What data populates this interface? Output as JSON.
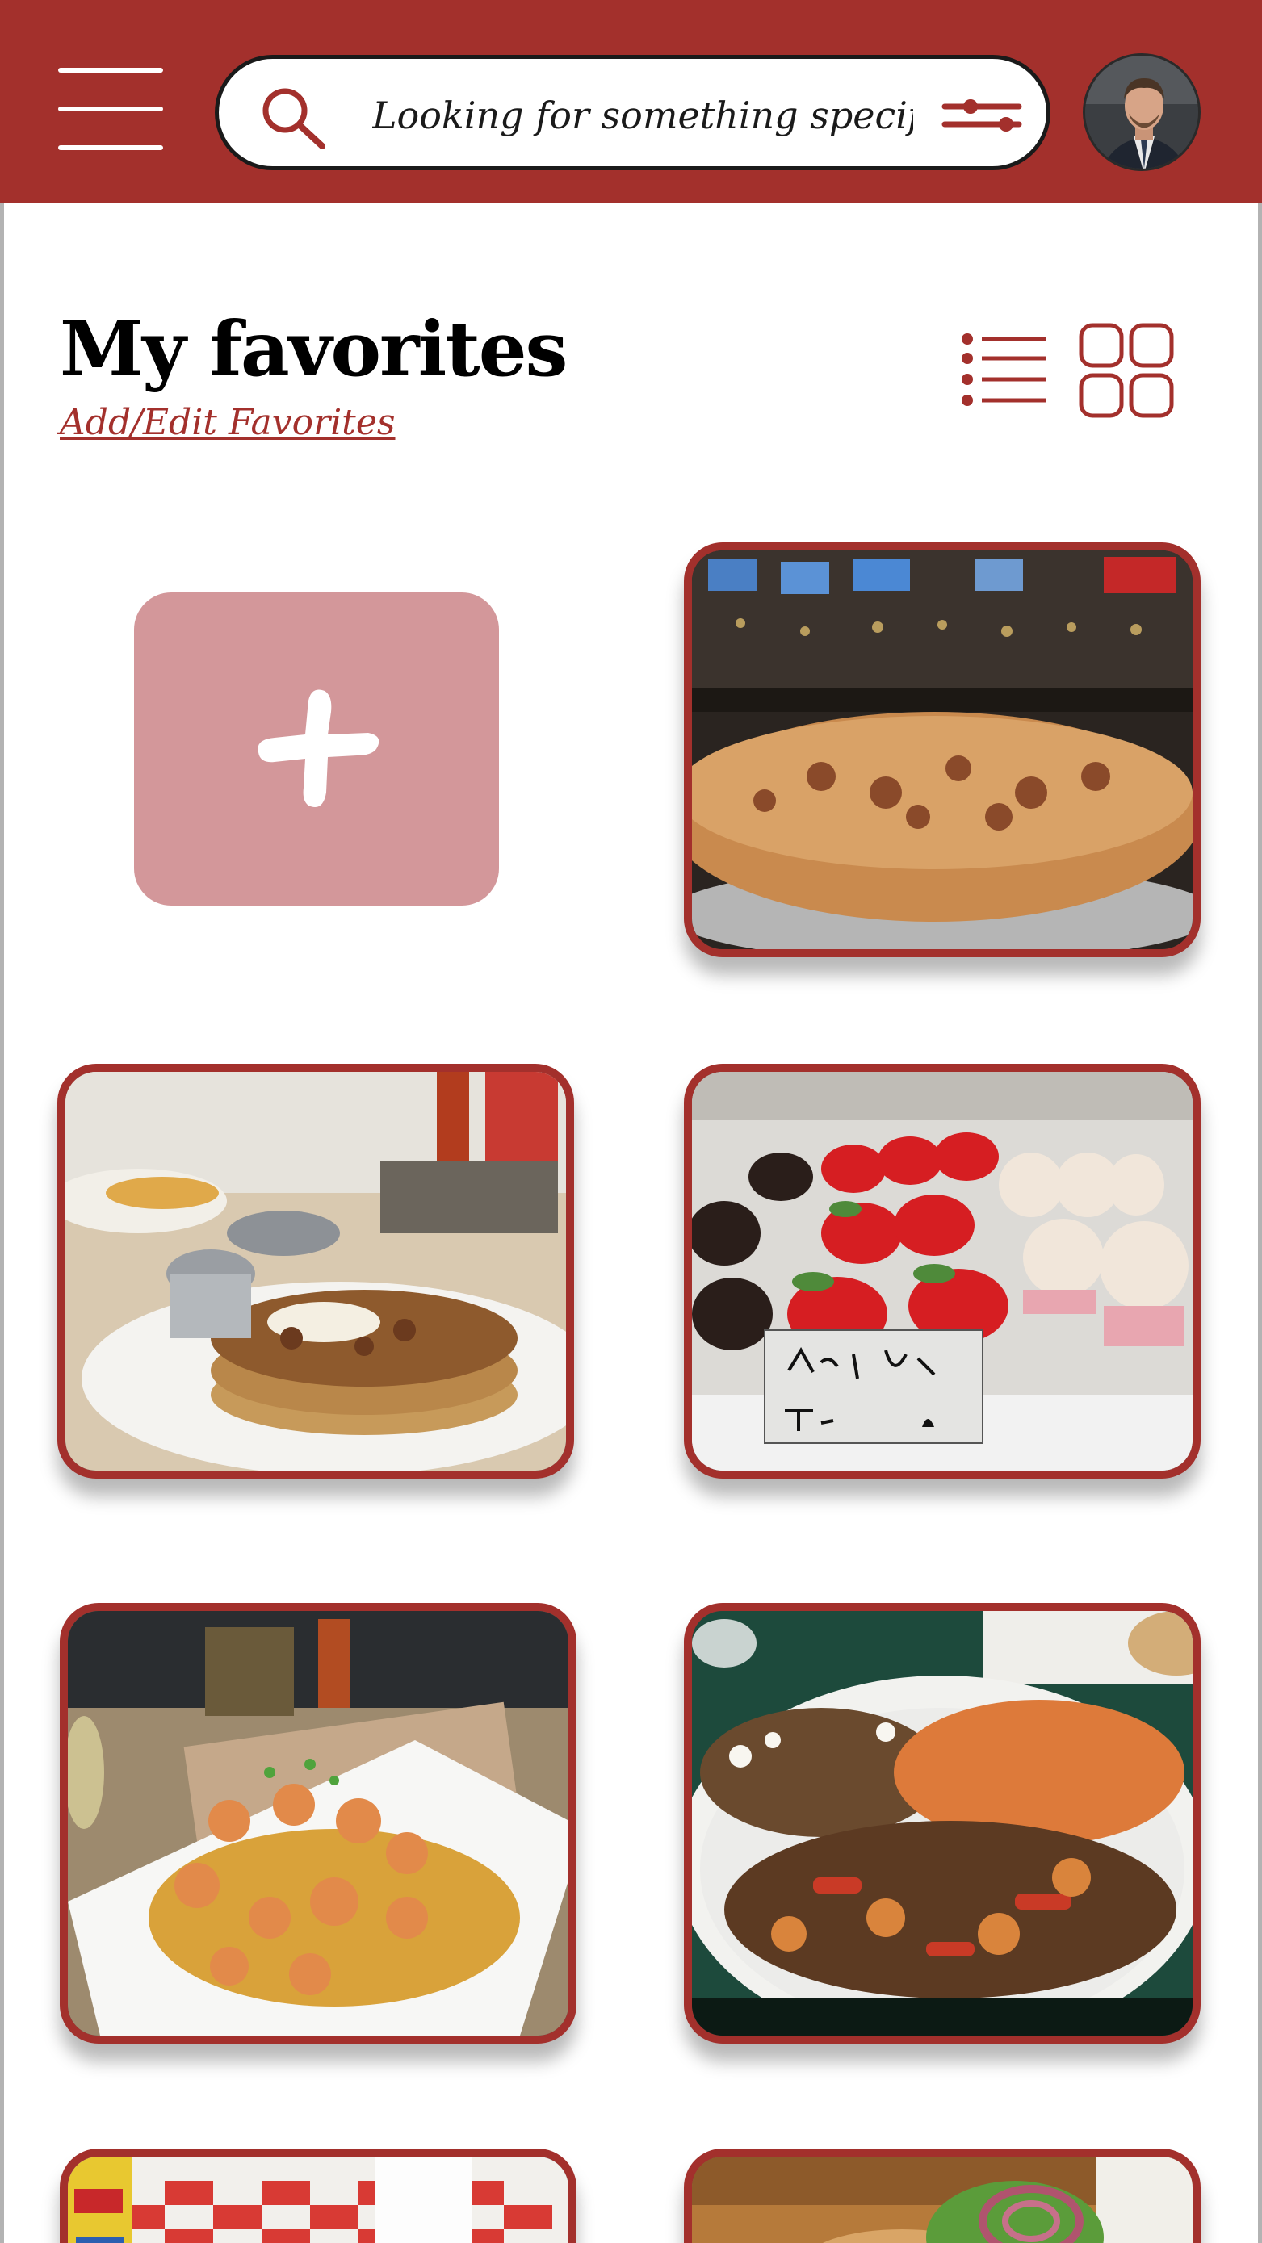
{
  "header": {
    "search_placeholder": "Looking for something specific?"
  },
  "page": {
    "title": "My favorites",
    "edit_link": "Add/Edit Favorites"
  },
  "colors": {
    "brand": "#a3302c",
    "add_tile": "#d3979a",
    "background": "#ffffff"
  },
  "icons": [
    "menu-icon",
    "search-icon",
    "filter-sliders-icon",
    "list-view-icon",
    "grid-view-icon",
    "plus-icon"
  ],
  "favorites": [
    {
      "name": "pizza photo"
    },
    {
      "name": "pancakes photo"
    },
    {
      "name": "desserts photo"
    },
    {
      "name": "shrimp dish photo"
    },
    {
      "name": "fajita platter photo"
    },
    {
      "name": "diner table photo"
    },
    {
      "name": "burger photo"
    }
  ]
}
